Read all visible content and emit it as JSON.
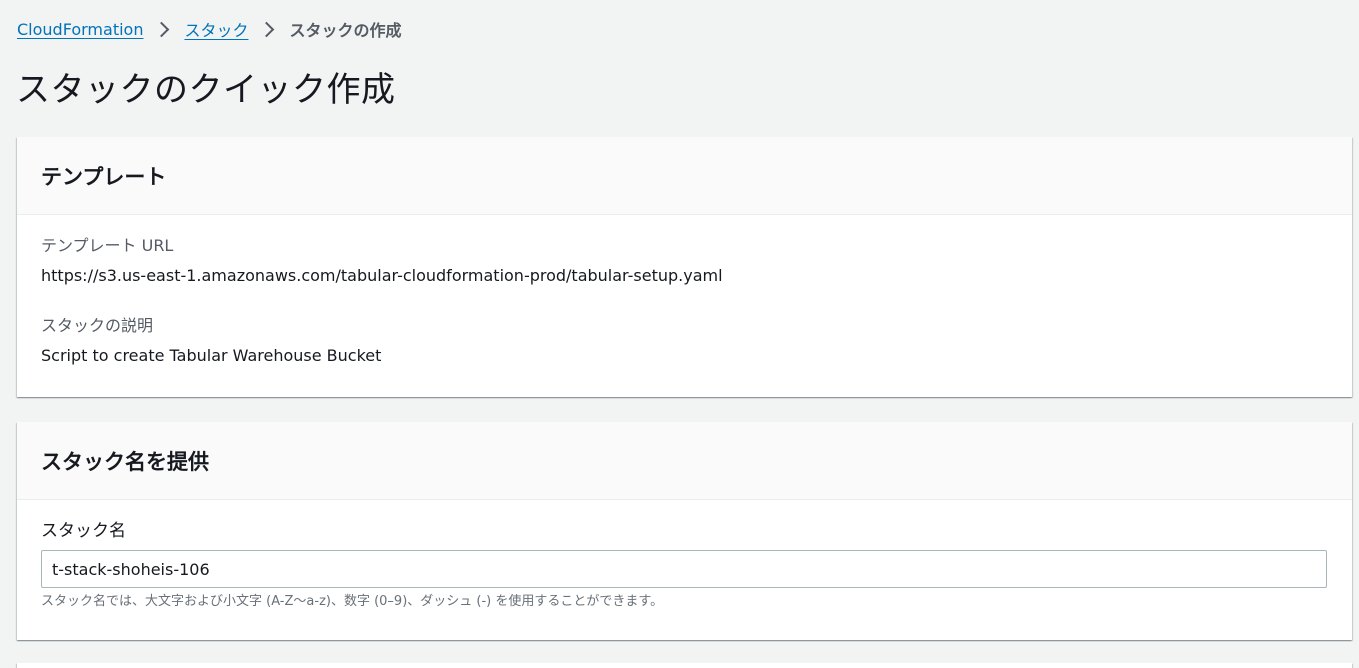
{
  "breadcrumb": {
    "items": [
      {
        "label": "CloudFormation"
      },
      {
        "label": "スタック"
      },
      {
        "label": "スタックの作成"
      }
    ]
  },
  "page": {
    "title": "スタックのクイック作成"
  },
  "template_panel": {
    "header": "テンプレート",
    "url_label": "テンプレート URL",
    "url_value": "https://s3.us-east-1.amazonaws.com/tabular-cloudformation-prod/tabular-setup.yaml",
    "desc_label": "スタックの説明",
    "desc_value": "Script to create Tabular Warehouse Bucket"
  },
  "stack_name_panel": {
    "header": "スタック名を提供",
    "field_label": "スタック名",
    "field_value": "t-stack-shoheis-106",
    "constraint": "スタック名では、大文字および小文字 (A-Z〜a-z)、数字 (0–9)、ダッシュ (-) を使用することができます。"
  },
  "colors": {
    "link": "#0073bb",
    "background": "#f2f3f3",
    "panel_header_bg": "#fafafa",
    "text_primary": "#16191f",
    "text_secondary": "#545b64"
  },
  "icons": {
    "breadcrumb_separator": "chevron-right-icon"
  }
}
